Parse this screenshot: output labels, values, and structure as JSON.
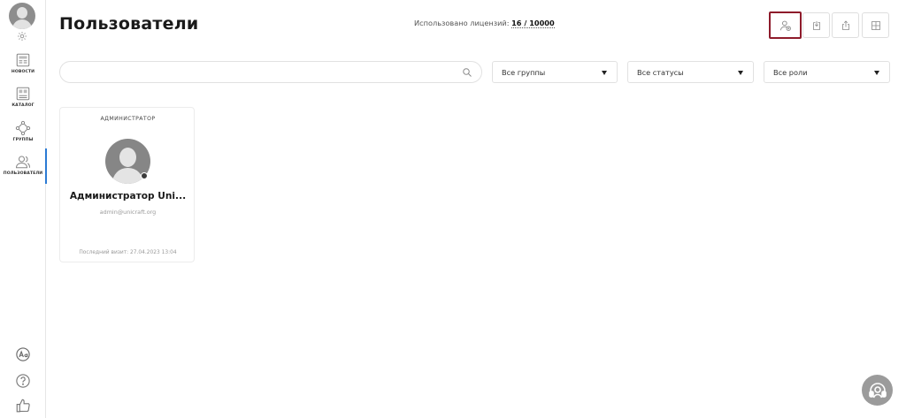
{
  "sidebar": {
    "items": [
      {
        "label": "НОВОСТИ"
      },
      {
        "label": "КАТАЛОГ"
      },
      {
        "label": "ГРУППЫ"
      },
      {
        "label": "ПОЛЬЗОВАТЕЛИ"
      }
    ]
  },
  "header": {
    "title": "Пользователи",
    "license_label": "Использовано лицензий:",
    "license_value": "16 / 10000"
  },
  "filters": {
    "search_placeholder": "",
    "groups": "Все группы",
    "statuses": "Все статусы",
    "roles": "Все роли"
  },
  "users": [
    {
      "role": "АДМИНИСТРАТОР",
      "name": "Администратор Uni...",
      "email": "admin@unicraft.org",
      "last_visit": "Последний визит: 27.04.2023 13:04"
    }
  ],
  "colors": {
    "highlight_border": "#8e1b2b",
    "active_indicator": "#2b7bd4"
  }
}
